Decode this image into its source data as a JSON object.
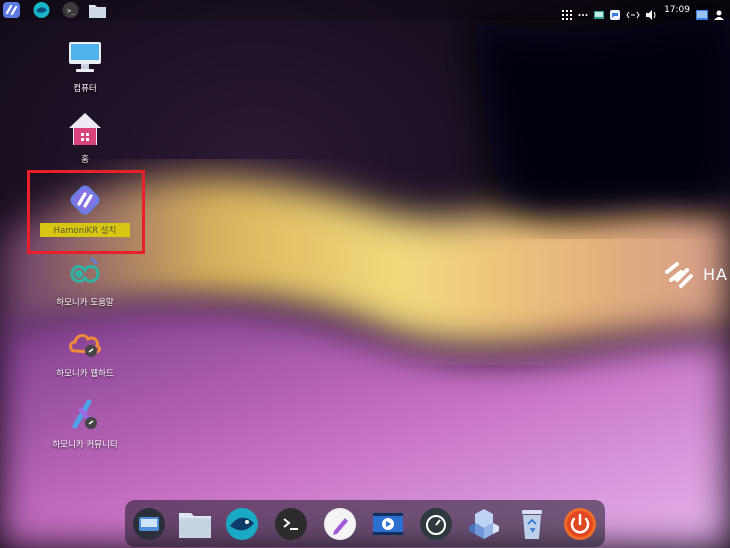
{
  "topbar": {
    "apps": [
      {
        "icon": "hamonikr-menu-icon"
      },
      {
        "icon": "whale-browser-icon"
      },
      {
        "icon": "terminal-icon"
      },
      {
        "icon": "file-manager-icon"
      }
    ],
    "tray": {
      "icons": [
        "app-grid-icon",
        "more-icon",
        "screen-icon",
        "chat-icon",
        "network-icon",
        "volume-icon"
      ],
      "clock": "17:09"
    }
  },
  "desktop": {
    "icons": [
      {
        "label": "컴퓨터",
        "icon": "computer-icon"
      },
      {
        "label": "홈",
        "icon": "home-folder-icon"
      },
      {
        "label": "HamoniKR 설치",
        "icon": "hamonikr-install-icon",
        "selected": true
      },
      {
        "label": "하모니카 도움말",
        "icon": "help-icon"
      },
      {
        "label": "하모니카 웹하드",
        "icon": "webhard-cloud-icon"
      },
      {
        "label": "하모니카 커뮤니티",
        "icon": "community-icon"
      }
    ]
  },
  "brand": {
    "text": "HA"
  },
  "dock": {
    "items": [
      "system-monitor-icon",
      "files-icon",
      "whale-browser-icon",
      "terminal-icon",
      "text-editor-icon",
      "video-player-icon",
      "timeshift-icon",
      "software-center-icon",
      "trash-icon",
      "power-icon"
    ]
  },
  "colors": {
    "selection_border": "#e8202a",
    "selection_label": "#d7c612"
  }
}
